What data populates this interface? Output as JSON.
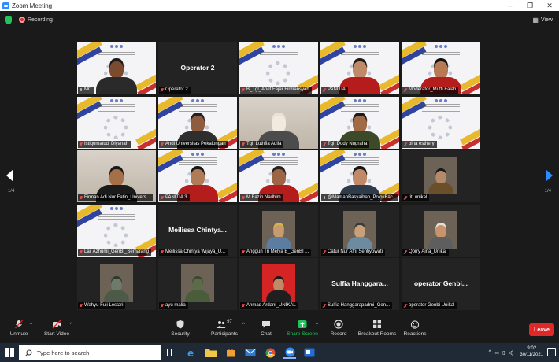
{
  "window": {
    "title": "Zoom Meeting",
    "controls": [
      "–",
      "❐",
      "✕"
    ]
  },
  "topbar": {
    "recording_label": "Recording",
    "view_label": "View"
  },
  "pages": {
    "left": "1/4",
    "right": "1/4"
  },
  "tiles": [
    {
      "name": "MC",
      "bg": "slide",
      "skin": "#7b4a2f",
      "hair": "#1a1a1a",
      "shirt": "#2a2a2a",
      "mic": "on",
      "speaking": true
    },
    {
      "name": "Operator 2",
      "bg": "dark",
      "big": "Operator 2",
      "mic": "off"
    },
    {
      "name": "B_Tgl_Arief Fajar Firmansyah",
      "bg": "slide",
      "mic": "off"
    },
    {
      "name": "PANITIA",
      "bg": "slide",
      "skin": "#c08a68",
      "hair": "#1f1a17",
      "shirt": "#b51d1d",
      "mic": "off"
    },
    {
      "name": "Moderator_Mufti Falah",
      "bg": "slide",
      "skin": "#b77a55",
      "hair": "#111",
      "shirt": "#b51d1d",
      "mic": "off"
    },
    {
      "name": "Istiqomatudi Diyanah",
      "bg": "slide",
      "mic": "off"
    },
    {
      "name": "Andi Universitas Pekalongan",
      "bg": "slide",
      "skin": "#8e5c3f",
      "hair": "#222",
      "shirt": "#2e2e2e",
      "mic": "off"
    },
    {
      "name": "Tgl_Luthfia Adila",
      "bg": "room",
      "skin": "#f0eadf",
      "hair": "#e8e2d6",
      "shirt": "#4c4c4c",
      "mic": "off"
    },
    {
      "name": "Tgl_Dody Nugraha",
      "bg": "slide",
      "skin": "#a06a47",
      "hair": "#1a1a1a",
      "shirt": "#3d4a2a",
      "mic": "off"
    },
    {
      "name": "bina esthery",
      "bg": "slide",
      "mic": "off"
    },
    {
      "name": "Firman Adi Nur Fatin_Univers...",
      "bg": "room",
      "skin": "#a46f49",
      "hair": "#181818",
      "shirt": "#1b1b1b",
      "mic": "off"
    },
    {
      "name": "PANITIA 3",
      "bg": "slide",
      "skin": "#b07b57",
      "hair": "#151515",
      "shirt": "#b51d1d",
      "mic": "off"
    },
    {
      "name": "M.Fazih Nadhim",
      "bg": "slide",
      "skin": "#9b6546",
      "hair": "#222",
      "shirt": "#b51d1d",
      "mic": "off"
    },
    {
      "name": "@MamanBasyaiban_PojokBac...",
      "bg": "slide",
      "skin": "#c08a68",
      "hair": "#141414",
      "shirt": "#2d3b4a",
      "mic": "on"
    },
    {
      "name": "titi unikal",
      "bg": "dark",
      "thumb": true,
      "skin": "#b58a6a",
      "hair": "#1a1a1a",
      "shirt": "#6b4f2a",
      "mic": "off"
    },
    {
      "name": "Lail Azhumi_GenBI_Semarang",
      "bg": "slide",
      "mic": "off"
    },
    {
      "name": "Meilissa Chintya Wijaya_U...",
      "bg": "dark",
      "big": "Meilissa Chintya...",
      "mic": "off"
    },
    {
      "name": "Anggun Tri Melya B_GenBI ...",
      "bg": "dark",
      "thumb": true,
      "skin": "#c79a70",
      "hair": "#d8b24a",
      "shirt": "#5d7da0",
      "mic": "off"
    },
    {
      "name": "Catur Nur Afni Sentiyowati",
      "bg": "dark",
      "thumb": true,
      "skin": "#caa07a",
      "hair": "#3a3a3a",
      "shirt": "#6c8aa0",
      "mic": "off"
    },
    {
      "name": "Qorry Aina_Unikal",
      "bg": "dark",
      "thumb": true,
      "skin": "#c8946e",
      "hair": "#e8e0d4",
      "shirt": "#5e5e5e",
      "mic": "off"
    },
    {
      "name": "Wahyu Fuji Lestari",
      "bg": "dark",
      "thumb": true,
      "skin": "#6f7a6a",
      "hair": "#2f3a30",
      "shirt": "#4d5a48",
      "mic": "off"
    },
    {
      "name": "ayu malia",
      "bg": "dark",
      "thumb": true,
      "skin": "#5c6b4a",
      "hair": "#3b4a2f",
      "shirt": "#4a5d3a",
      "mic": "off"
    },
    {
      "name": "Ahmad Ardani_UNIKAL",
      "bg": "dark",
      "thumb": true,
      "skin": "#c08a68",
      "hair": "#1a1a1a",
      "shirt": "#1f1f1f",
      "mic": "off",
      "thumb_bg": "#d42424"
    },
    {
      "name": "Sulfia Hanggarapadmi_Gen...",
      "bg": "dark",
      "big": "Sulfia Hanggara...",
      "mic": "off"
    },
    {
      "name": "operator Genbi Unikal",
      "bg": "dark",
      "big": "operator Genbi...",
      "mic": "off"
    }
  ],
  "toolbar": {
    "unmute": "Unmute",
    "start_video": "Start Video",
    "security": "Security",
    "participants": "Participants",
    "participants_count": "97",
    "chat": "Chat",
    "share_screen": "Share Screen",
    "record": "Record",
    "breakout_rooms": "Breakout Rooms",
    "reactions": "Reactions",
    "leave": "Leave"
  },
  "taskbar": {
    "search_placeholder": "Type here to search",
    "time": "9:02",
    "date": "30/11/2021"
  },
  "colors": {
    "accent": "#2d8cff",
    "leave": "#e02828",
    "share": "#23c25a",
    "speaking": "#b9e64a"
  }
}
